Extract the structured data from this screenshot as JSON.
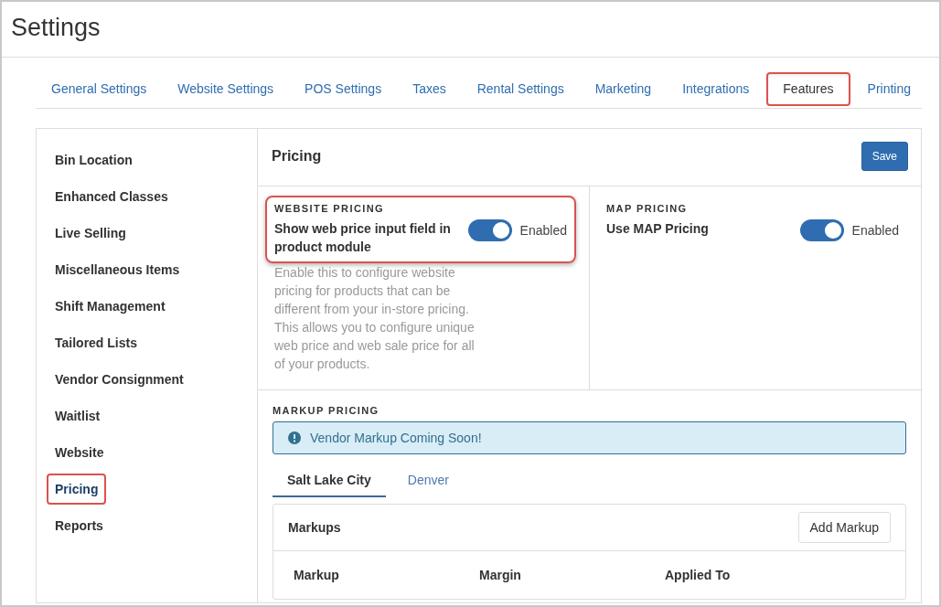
{
  "page": {
    "title": "Settings"
  },
  "tabs": [
    {
      "label": "General Settings",
      "selected": false,
      "highlighted": false
    },
    {
      "label": "Website Settings",
      "selected": false,
      "highlighted": false
    },
    {
      "label": "POS Settings",
      "selected": false,
      "highlighted": false
    },
    {
      "label": "Taxes",
      "selected": false,
      "highlighted": false
    },
    {
      "label": "Rental Settings",
      "selected": false,
      "highlighted": false
    },
    {
      "label": "Marketing",
      "selected": false,
      "highlighted": false
    },
    {
      "label": "Integrations",
      "selected": false,
      "highlighted": false
    },
    {
      "label": "Features",
      "selected": true,
      "highlighted": true
    },
    {
      "label": "Printing",
      "selected": false,
      "highlighted": false
    }
  ],
  "sidebar": {
    "items": [
      {
        "label": "Bin Location",
        "selected": false,
        "highlighted": false
      },
      {
        "label": "Enhanced Classes",
        "selected": false,
        "highlighted": false
      },
      {
        "label": "Live Selling",
        "selected": false,
        "highlighted": false
      },
      {
        "label": "Miscellaneous Items",
        "selected": false,
        "highlighted": false
      },
      {
        "label": "Shift Management",
        "selected": false,
        "highlighted": false
      },
      {
        "label": "Tailored Lists",
        "selected": false,
        "highlighted": false
      },
      {
        "label": "Vendor Consignment",
        "selected": false,
        "highlighted": false
      },
      {
        "label": "Waitlist",
        "selected": false,
        "highlighted": false
      },
      {
        "label": "Website",
        "selected": false,
        "highlighted": false
      },
      {
        "label": "Pricing",
        "selected": true,
        "highlighted": true
      },
      {
        "label": "Reports",
        "selected": false,
        "highlighted": false
      }
    ]
  },
  "panel": {
    "title": "Pricing",
    "save_button": "Save",
    "settings": [
      {
        "heading": "WEBSITE PRICING",
        "label": "Show web price input field in product module",
        "on": true,
        "toggle_label": "Enabled",
        "description": "Enable this to configure website pricing for products that can be different from your in-store pricing. This allows you to configure unique web price and web sale price for all of your products.",
        "highlighted": true
      },
      {
        "heading": "MAP PRICING",
        "label": "Use MAP Pricing",
        "on": true,
        "toggle_label": "Enabled",
        "highlighted": false
      }
    ],
    "markup": {
      "heading": "MARKUP PRICING",
      "alert": "Vendor Markup Coming Soon!",
      "location_tabs": [
        {
          "label": "Salt Lake City",
          "selected": true
        },
        {
          "label": "Denver",
          "selected": false
        }
      ],
      "card": {
        "title": "Markups",
        "add_button": "Add Markup",
        "columns": [
          "Markup",
          "Margin",
          "Applied To"
        ]
      }
    }
  }
}
